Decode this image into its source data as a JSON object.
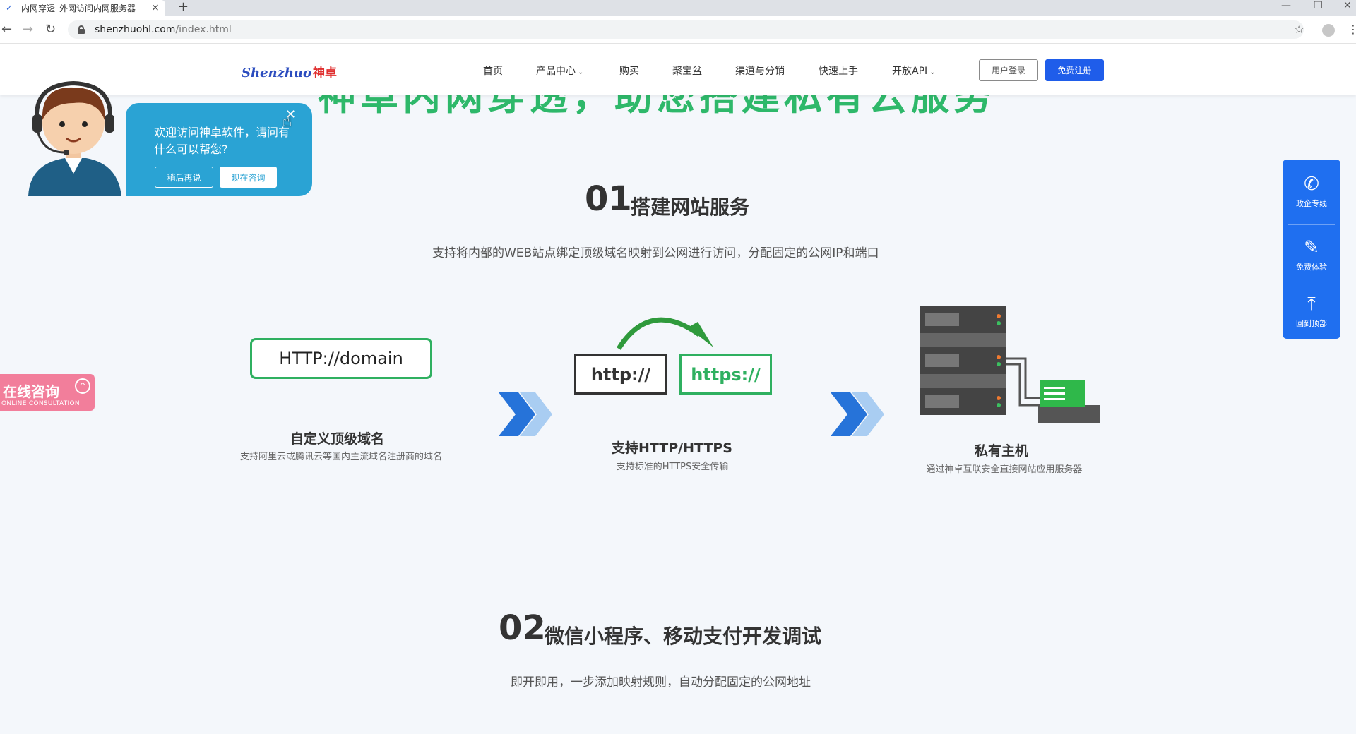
{
  "browser": {
    "tab_title": "内网穿透_外网访问内网服务器_",
    "tab_close": "×",
    "new_tab": "+",
    "url_domain": "shenzhuohl.com",
    "url_path": "/index.html"
  },
  "header": {
    "logo_en": "Shenzhuo",
    "logo_cn": "神卓",
    "nav": [
      {
        "label": "首页"
      },
      {
        "label": "产品中心",
        "caret": "⌄"
      },
      {
        "label": "购买"
      },
      {
        "label": "聚宝盆"
      },
      {
        "label": "渠道与分销"
      },
      {
        "label": "快速上手"
      },
      {
        "label": "开放API",
        "caret": "⌄"
      }
    ],
    "login": "用户登录",
    "register": "免费注册"
  },
  "hidden_heading": "神卓内网穿透，助您搭建私有云服务",
  "chat": {
    "message": "欢迎访问神卓软件，请问有什么可以帮您?",
    "later": "稍后再说",
    "now": "现在咨询"
  },
  "online_consult": {
    "label": "在线咨询",
    "sub": "ONLINE CONSULTATION"
  },
  "sidebar": {
    "items": [
      {
        "label": "政企专线",
        "icon": "phone-icon"
      },
      {
        "label": "免费体验",
        "icon": "edit-icon"
      },
      {
        "label": "回到顶部",
        "icon": "back-to-top-icon"
      }
    ]
  },
  "section1": {
    "number": "01",
    "title": "搭建网站服务",
    "desc": "支持将内部的WEB站点绑定顶级域名映射到公网进行访问，分配固定的公网IP和端口",
    "domain_box": "HTTP://domain",
    "http": "http://",
    "https": "https://",
    "features": [
      {
        "title": "自定义顶级域名",
        "desc": "支持阿里云或腾讯云等国内主流域名注册商的域名"
      },
      {
        "title": "支持HTTP/HTTPS",
        "desc": "支持标准的HTTPS安全传输"
      },
      {
        "title": "私有主机",
        "desc": "通过神卓互联安全直接网站应用服务器"
      }
    ]
  },
  "section2": {
    "number": "02",
    "title": "微信小程序、移动支付开发调试",
    "desc": "即开即用，一步添加映射规则，自动分配固定的公网地址"
  },
  "colors": {
    "brand_blue": "#1f5dea",
    "green": "#2fb060",
    "chat_blue": "#2aa3d4",
    "pink": "#f27e9b"
  }
}
